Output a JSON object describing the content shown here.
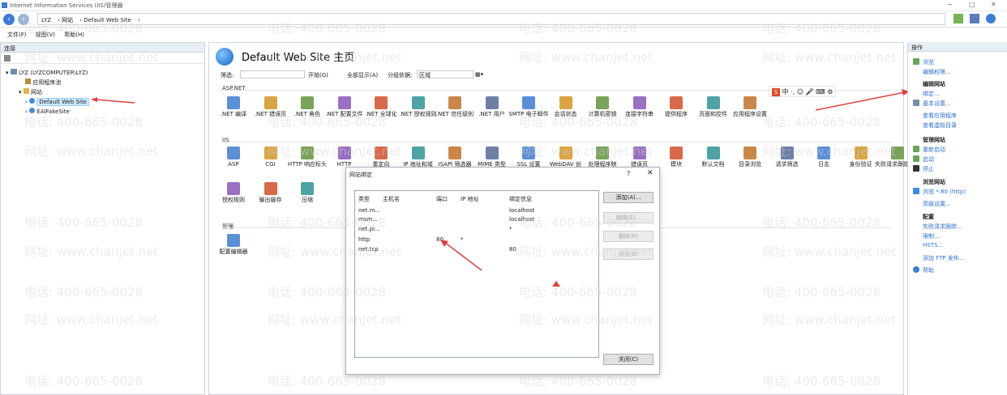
{
  "window": {
    "title": "Internet Information Services (IIS)管理器"
  },
  "address": {
    "path": [
      "LYZ",
      "网站",
      "Default Web Site"
    ]
  },
  "menu": {
    "items": [
      "文件(F)",
      "视图(V)",
      "帮助(H)"
    ]
  },
  "left": {
    "header": "连接",
    "tree": [
      {
        "label": "LYZ (LYZCOMPUTER\\LYZ)",
        "depth": 0
      },
      {
        "label": "应用程序池",
        "depth": 1
      },
      {
        "label": "网站",
        "depth": 1
      },
      {
        "label": "Default Web Site",
        "depth": 2,
        "selected": true
      },
      {
        "label": "EAIFakeSite",
        "depth": 2
      }
    ]
  },
  "center": {
    "title": "Default Web Site 主页",
    "filter": {
      "label": "筛选:",
      "start": "开始(G)",
      "show_all": "全部显示(A)",
      "group_label": "分组依据:",
      "group_value": "区域"
    },
    "sections": [
      {
        "name": "ASP.NET",
        "items": [
          ".NET 编译",
          ".NET 错误页",
          ".NET 角色",
          ".NET 配置文件",
          ".NET 全球化",
          ".NET 授权规则",
          ".NET 信任级别",
          ".NET 用户",
          "SMTP 电子邮件",
          "会话状态",
          "计算机密钥",
          "连接字符串",
          "提供程序",
          "页面和控件",
          "应用程序设置"
        ]
      },
      {
        "name": "IIS",
        "items": [
          "ASP",
          "CGI",
          "HTTP 响应标头",
          "HTTP",
          "重定向",
          "IP 地址和域",
          "ISAPI 筛选器",
          "MIME 类型",
          "SSL 设置",
          "WebDAV 创",
          "处理程序映",
          "错误页",
          "模块",
          "默认文档",
          "目录浏览",
          "请求筛选",
          "日志",
          "身份验证",
          "失败请求跟踪规则",
          "授权规则",
          "输出缓存",
          "压缩"
        ]
      },
      {
        "name": "管理",
        "items": [
          "配置编辑器"
        ]
      }
    ]
  },
  "right": {
    "header": "操作",
    "actions": [
      "浏览",
      "编辑权限..."
    ],
    "edit_site_title": "编辑网站",
    "edit_site": [
      "绑定...",
      "基本设置...",
      "查看应用程序",
      "查看虚拟目录"
    ],
    "manage_title": "管理网站",
    "manage": [
      "重新启动",
      "启动",
      "停止"
    ],
    "browse_title": "浏览网站",
    "browse": [
      "浏览 *:80 (http)"
    ],
    "advanced": "高级设置...",
    "config_title": "配置",
    "config": [
      "失败请求跟踪...",
      "限制...",
      "HSTS..."
    ],
    "ftp": "添加 FTP 发布...",
    "help": "帮助"
  },
  "dialog": {
    "title": "网站绑定",
    "question": "?",
    "columns": [
      "类型",
      "主机名",
      "端口",
      "IP 地址",
      "绑定信息"
    ],
    "rows": [
      [
        "net.m...",
        "",
        "",
        "",
        "localhost"
      ],
      [
        "msm...",
        "",
        "",
        "",
        "localhost"
      ],
      [
        "net.pi...",
        "",
        "",
        "",
        "*"
      ],
      [
        "http",
        "",
        "80",
        "*",
        ""
      ],
      [
        "net.tcp",
        "",
        "",
        "",
        "80"
      ]
    ],
    "buttons": {
      "add": "添加(A)...",
      "edit": "编辑(E)...",
      "remove": "删除(R)",
      "browse": "浏览(B)",
      "close": "关闭(C)"
    }
  },
  "ime": {
    "label": "中 ·, ☺ 🎤 ⌨ ⚙"
  },
  "watermark": {
    "phone": "电话: 400-665-0028",
    "site": "网址: www.chanjet.net"
  },
  "colors": {
    "accent": "#2a6fd1",
    "selection": "#cce8ff",
    "arrow": "#e04040"
  }
}
